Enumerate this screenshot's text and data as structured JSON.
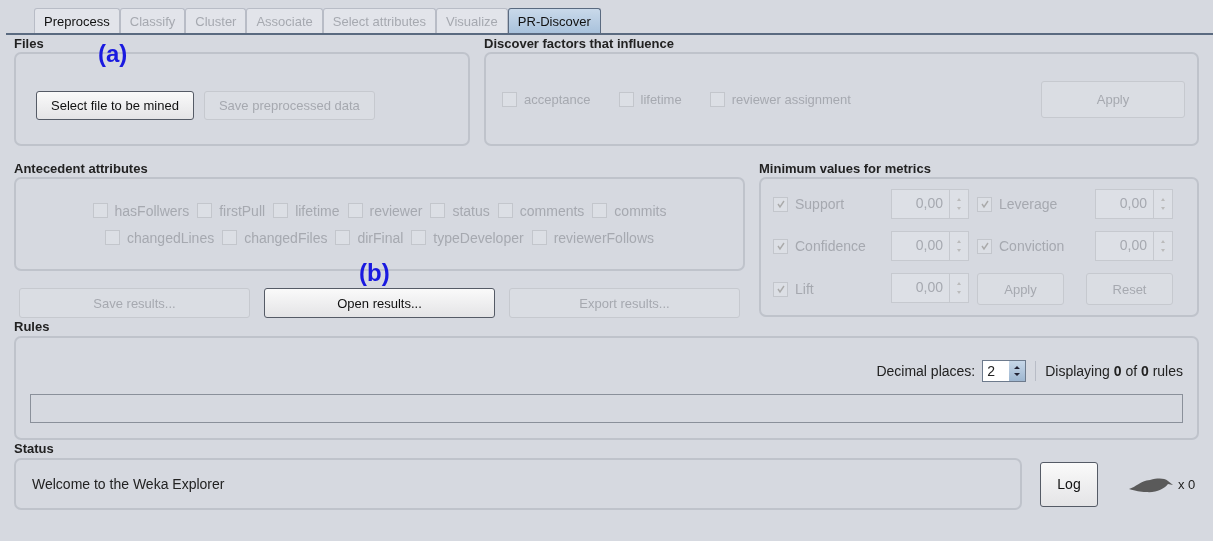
{
  "tabs": [
    {
      "label": "Preprocess",
      "selected": false,
      "disabled": false
    },
    {
      "label": "Classify",
      "selected": false,
      "disabled": true
    },
    {
      "label": "Cluster",
      "selected": false,
      "disabled": true
    },
    {
      "label": "Associate",
      "selected": false,
      "disabled": true
    },
    {
      "label": "Select attributes",
      "selected": false,
      "disabled": true
    },
    {
      "label": "Visualize",
      "selected": false,
      "disabled": true
    },
    {
      "label": "PR-Discover",
      "selected": true,
      "disabled": false
    }
  ],
  "files": {
    "title": "Files",
    "annotation": "(a)",
    "buttons": [
      {
        "label": "Select file to be mined",
        "disabled": false
      },
      {
        "label": "Save preprocessed data",
        "disabled": true
      }
    ]
  },
  "discover": {
    "title": "Discover factors that influence",
    "options": [
      {
        "label": "acceptance",
        "checked": false,
        "disabled": true
      },
      {
        "label": "lifetime",
        "checked": false,
        "disabled": true
      },
      {
        "label": "reviewer assignment",
        "checked": false,
        "disabled": true
      }
    ],
    "apply_button": {
      "label": "Apply",
      "disabled": true
    }
  },
  "antecedent": {
    "title": "Antecedent attributes",
    "rows": [
      {
        "items": [
          {
            "label": "hasFollwers",
            "checked": false,
            "disabled": true
          },
          {
            "label": "firstPull",
            "checked": false,
            "disabled": true
          },
          {
            "label": "lifetime",
            "checked": false,
            "disabled": true
          },
          {
            "label": "reviewer",
            "checked": false,
            "disabled": true
          },
          {
            "label": "status",
            "checked": false,
            "disabled": true
          },
          {
            "label": "comments",
            "checked": false,
            "disabled": true
          },
          {
            "label": "commits",
            "checked": false,
            "disabled": true
          }
        ]
      },
      {
        "items": [
          {
            "label": "changedLines",
            "checked": false,
            "disabled": true
          },
          {
            "label": "changedFiles",
            "checked": false,
            "disabled": true
          },
          {
            "label": "dirFinal",
            "checked": false,
            "disabled": true
          },
          {
            "label": "typeDeveloper",
            "checked": false,
            "disabled": true
          },
          {
            "label": "reviewerFollows",
            "checked": false,
            "disabled": true
          }
        ]
      }
    ]
  },
  "results": {
    "annotation": "(b)",
    "buttons": [
      {
        "label": "Save results...",
        "disabled": true
      },
      {
        "label": "Open results...",
        "disabled": false
      },
      {
        "label": "Export results...",
        "disabled": true
      }
    ]
  },
  "metrics": {
    "title": "Minimum values for metrics",
    "items": [
      {
        "label": "Support",
        "checked": true,
        "disabled": true,
        "value": "0,00"
      },
      {
        "label": "Leverage",
        "checked": true,
        "disabled": true,
        "value": "0,00"
      },
      {
        "label": "Confidence",
        "checked": true,
        "disabled": true,
        "value": "0,00"
      },
      {
        "label": "Conviction",
        "checked": true,
        "disabled": true,
        "value": "0,00"
      },
      {
        "label": "Lift",
        "checked": true,
        "disabled": true,
        "value": "0,00"
      }
    ],
    "buttons": [
      {
        "label": "Apply",
        "disabled": true
      },
      {
        "label": "Reset",
        "disabled": true
      }
    ]
  },
  "rules": {
    "title": "Rules",
    "decimal_label": "Decimal places:",
    "decimal_value": "2",
    "displaying": "Displaying **0** of **0** rules",
    "progress": {
      "level": 0
    }
  },
  "status": {
    "title": "Status",
    "message": "Welcome to the Weka Explorer",
    "log_button": "Log",
    "count": "x 0"
  }
}
